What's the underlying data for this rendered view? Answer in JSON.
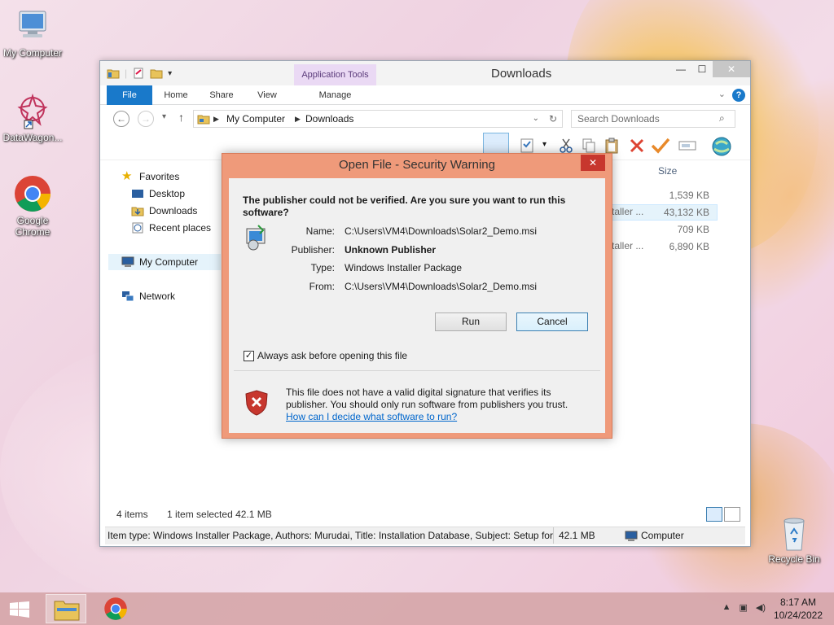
{
  "desktop": {
    "icons": [
      {
        "label": "My Computer"
      },
      {
        "label": "DataWagon..."
      },
      {
        "label": "Google Chrome"
      },
      {
        "label": "Recycle Bin"
      }
    ]
  },
  "explorer": {
    "title": "Downloads",
    "contextual_tab_group": "Application Tools",
    "tabs": {
      "file": "File",
      "home": "Home",
      "share": "Share",
      "view": "View",
      "manage": "Manage"
    },
    "breadcrumb": [
      "My Computer",
      "Downloads"
    ],
    "search_placeholder": "Search Downloads",
    "nav_pane": {
      "favorites": "Favorites",
      "desktop": "Desktop",
      "downloads": "Downloads",
      "recent": "Recent places",
      "computer": "My Computer",
      "network": "Network"
    },
    "columns": {
      "size": "Size"
    },
    "files": [
      {
        "type": "",
        "size": "1,539 KB"
      },
      {
        "type": "staller ...",
        "size": "43,132 KB"
      },
      {
        "type": "",
        "size": "709 KB"
      },
      {
        "type": "staller ...",
        "size": "6,890 KB"
      }
    ],
    "status": {
      "items": "4 items",
      "selected": "1 item selected  42.1 MB"
    },
    "details": {
      "text": "Item type: Windows Installer Package, Authors: Murudai, Title: Installation Database, Subject: Setup for",
      "size": "42.1 MB",
      "location": "Computer"
    }
  },
  "dialog": {
    "title": "Open File - Security Warning",
    "close": "✕",
    "question": "The publisher could not be verified.  Are you sure you want to run this software?",
    "fields": {
      "name_label": "Name:",
      "name_value": "C:\\Users\\VM4\\Downloads\\Solar2_Demo.msi",
      "publisher_label": "Publisher:",
      "publisher_value": "Unknown Publisher",
      "type_label": "Type:",
      "type_value": "Windows Installer Package",
      "from_label": "From:",
      "from_value": "C:\\Users\\VM4\\Downloads\\Solar2_Demo.msi"
    },
    "run_label": "Run",
    "cancel_label": "Cancel",
    "checkbox_label": "Always ask before opening this file",
    "checkbox_checked": true,
    "warning": "This file does not have a valid digital signature that verifies its publisher.  You should only run software from publishers you trust.",
    "link": "How can I decide what software to run?"
  },
  "taskbar": {
    "time": "8:17 AM",
    "date": "10/24/2022"
  },
  "colors": {
    "dialog_frame": "#ef9a7a",
    "close_red": "#c7372e",
    "ribbon_blue": "#1979ca",
    "taskbar": "#d6a7aa"
  }
}
